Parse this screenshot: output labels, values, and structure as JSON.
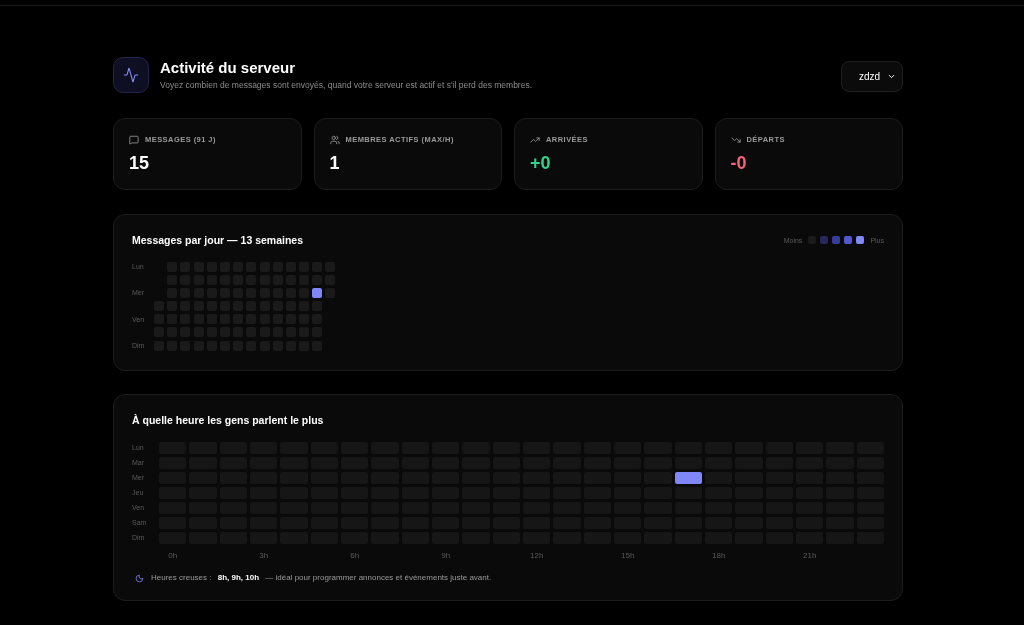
{
  "header": {
    "title": "Activité du serveur",
    "subtitle": "Voyez combien de messages sont envoyés, quand votre serveur est actif et s'il perd des membres."
  },
  "server_select": {
    "value": "zdzd"
  },
  "stats": [
    {
      "kind": "messages",
      "label": "MESSAGES (91 J)",
      "value": "15"
    },
    {
      "kind": "members",
      "label": "MEMBRES ACTIFS (MAX/H)",
      "value": "1"
    },
    {
      "kind": "arrivals",
      "label": "ARRIVÉES",
      "value": "+0"
    },
    {
      "kind": "departures",
      "label": "DÉPARTS",
      "value": "-0"
    }
  ],
  "daily_heatmap": {
    "title": "Messages par jour — 13 semaines",
    "legend": {
      "low": "Moins",
      "high": "Plus",
      "steps": [
        {
          "color": "#1a1a1a"
        },
        {
          "color": "#27285a"
        },
        {
          "color": "#3a3d94"
        },
        {
          "color": "#5459cc"
        },
        {
          "color": "#8087f6"
        }
      ]
    },
    "day_labels": [
      "Lun",
      "Mer",
      "Ven",
      "Dim"
    ],
    "weeks": [
      {
        "days": [
          {
            "color": "#1a1a1a"
          },
          {
            "color": "#1a1a1a"
          },
          {
            "color": "#1a1a1a"
          },
          {
            "color": "#1a1a1a"
          }
        ]
      },
      {
        "days": [
          {
            "color": "#1a1a1a"
          },
          {
            "color": "#1a1a1a"
          },
          {
            "color": "#1a1a1a"
          },
          {
            "color": "#1a1a1a"
          },
          {
            "color": "#1a1a1a"
          },
          {
            "color": "#1a1a1a"
          },
          {
            "color": "#1a1a1a"
          }
        ]
      },
      {
        "days": [
          {
            "color": "#1a1a1a"
          },
          {
            "color": "#1a1a1a"
          },
          {
            "color": "#1a1a1a"
          },
          {
            "color": "#1a1a1a"
          },
          {
            "color": "#1a1a1a"
          },
          {
            "color": "#1a1a1a"
          },
          {
            "color": "#1a1a1a"
          }
        ]
      },
      {
        "days": [
          {
            "color": "#1a1a1a"
          },
          {
            "color": "#1a1a1a"
          },
          {
            "color": "#1a1a1a"
          },
          {
            "color": "#1a1a1a"
          },
          {
            "color": "#1a1a1a"
          },
          {
            "color": "#1a1a1a"
          },
          {
            "color": "#1a1a1a"
          }
        ]
      },
      {
        "days": [
          {
            "color": "#1a1a1a"
          },
          {
            "color": "#1a1a1a"
          },
          {
            "color": "#1a1a1a"
          },
          {
            "color": "#1a1a1a"
          },
          {
            "color": "#1a1a1a"
          },
          {
            "color": "#1a1a1a"
          },
          {
            "color": "#1a1a1a"
          }
        ]
      },
      {
        "days": [
          {
            "color": "#1a1a1a"
          },
          {
            "color": "#1a1a1a"
          },
          {
            "color": "#1a1a1a"
          },
          {
            "color": "#1a1a1a"
          },
          {
            "color": "#1a1a1a"
          },
          {
            "color": "#1a1a1a"
          },
          {
            "color": "#1a1a1a"
          }
        ]
      },
      {
        "days": [
          {
            "color": "#1a1a1a"
          },
          {
            "color": "#1a1a1a"
          },
          {
            "color": "#1a1a1a"
          },
          {
            "color": "#1a1a1a"
          },
          {
            "color": "#1a1a1a"
          },
          {
            "color": "#1a1a1a"
          },
          {
            "color": "#1a1a1a"
          }
        ]
      },
      {
        "days": [
          {
            "color": "#1a1a1a"
          },
          {
            "color": "#1a1a1a"
          },
          {
            "color": "#1a1a1a"
          },
          {
            "color": "#1a1a1a"
          },
          {
            "color": "#1a1a1a"
          },
          {
            "color": "#1a1a1a"
          },
          {
            "color": "#1a1a1a"
          }
        ]
      },
      {
        "days": [
          {
            "color": "#1a1a1a"
          },
          {
            "color": "#1a1a1a"
          },
          {
            "color": "#1a1a1a"
          },
          {
            "color": "#1a1a1a"
          },
          {
            "color": "#1a1a1a"
          },
          {
            "color": "#1a1a1a"
          },
          {
            "color": "#1a1a1a"
          }
        ]
      },
      {
        "days": [
          {
            "color": "#1a1a1a"
          },
          {
            "color": "#1a1a1a"
          },
          {
            "color": "#1a1a1a"
          },
          {
            "color": "#1a1a1a"
          },
          {
            "color": "#1a1a1a"
          },
          {
            "color": "#1a1a1a"
          },
          {
            "color": "#1a1a1a"
          }
        ]
      },
      {
        "days": [
          {
            "color": "#1a1a1a"
          },
          {
            "color": "#1a1a1a"
          },
          {
            "color": "#1a1a1a"
          },
          {
            "color": "#1a1a1a"
          },
          {
            "color": "#1a1a1a"
          },
          {
            "color": "#1a1a1a"
          },
          {
            "color": "#1a1a1a"
          }
        ]
      },
      {
        "days": [
          {
            "color": "#1a1a1a"
          },
          {
            "color": "#1a1a1a"
          },
          {
            "color": "#1a1a1a"
          },
          {
            "color": "#1a1a1a"
          },
          {
            "color": "#1a1a1a"
          },
          {
            "color": "#1a1a1a"
          },
          {
            "color": "#1a1a1a"
          }
        ]
      },
      {
        "days": [
          {
            "color": "#1a1a1a"
          },
          {
            "color": "#1a1a1a"
          },
          {
            "color": "#8087f6"
          },
          {
            "color": "#1a1a1a"
          },
          {
            "color": "#1a1a1a"
          },
          {
            "color": "#1a1a1a"
          },
          {
            "color": "#1a1a1a"
          }
        ]
      },
      {
        "days": [
          {
            "color": "#1a1a1a"
          },
          {
            "color": "#1a1a1a"
          },
          {
            "color": "#1a1a1a"
          }
        ]
      }
    ]
  },
  "hourly_heatmap": {
    "title": "À quelle heure les gens parlent le plus",
    "rows": [
      {
        "label": "Lun",
        "cells": [
          {
            "color": "#161616"
          },
          {
            "color": "#161616"
          },
          {
            "color": "#161616"
          },
          {
            "color": "#161616"
          },
          {
            "color": "#161616"
          },
          {
            "color": "#161616"
          },
          {
            "color": "#161616"
          },
          {
            "color": "#161616"
          },
          {
            "color": "#161616"
          },
          {
            "color": "#161616"
          },
          {
            "color": "#161616"
          },
          {
            "color": "#161616"
          },
          {
            "color": "#161616"
          },
          {
            "color": "#161616"
          },
          {
            "color": "#161616"
          },
          {
            "color": "#161616"
          },
          {
            "color": "#161616"
          },
          {
            "color": "#161616"
          },
          {
            "color": "#161616"
          },
          {
            "color": "#161616"
          },
          {
            "color": "#161616"
          },
          {
            "color": "#161616"
          },
          {
            "color": "#161616"
          },
          {
            "color": "#161616"
          }
        ]
      },
      {
        "label": "Mar",
        "cells": [
          {
            "color": "#161616"
          },
          {
            "color": "#161616"
          },
          {
            "color": "#161616"
          },
          {
            "color": "#161616"
          },
          {
            "color": "#161616"
          },
          {
            "color": "#161616"
          },
          {
            "color": "#161616"
          },
          {
            "color": "#161616"
          },
          {
            "color": "#161616"
          },
          {
            "color": "#161616"
          },
          {
            "color": "#161616"
          },
          {
            "color": "#161616"
          },
          {
            "color": "#161616"
          },
          {
            "color": "#161616"
          },
          {
            "color": "#161616"
          },
          {
            "color": "#161616"
          },
          {
            "color": "#161616"
          },
          {
            "color": "#161616"
          },
          {
            "color": "#161616"
          },
          {
            "color": "#161616"
          },
          {
            "color": "#161616"
          },
          {
            "color": "#161616"
          },
          {
            "color": "#161616"
          },
          {
            "color": "#161616"
          }
        ]
      },
      {
        "label": "Mer",
        "cells": [
          {
            "color": "#161616"
          },
          {
            "color": "#161616"
          },
          {
            "color": "#161616"
          },
          {
            "color": "#161616"
          },
          {
            "color": "#161616"
          },
          {
            "color": "#161616"
          },
          {
            "color": "#161616"
          },
          {
            "color": "#161616"
          },
          {
            "color": "#161616"
          },
          {
            "color": "#161616"
          },
          {
            "color": "#161616"
          },
          {
            "color": "#161616"
          },
          {
            "color": "#161616"
          },
          {
            "color": "#161616"
          },
          {
            "color": "#161616"
          },
          {
            "color": "#161616"
          },
          {
            "color": "#161616"
          },
          {
            "color": "#8087f6"
          },
          {
            "color": "#161616"
          },
          {
            "color": "#161616"
          },
          {
            "color": "#161616"
          },
          {
            "color": "#161616"
          },
          {
            "color": "#161616"
          },
          {
            "color": "#161616"
          }
        ]
      },
      {
        "label": "Jeu",
        "cells": [
          {
            "color": "#161616"
          },
          {
            "color": "#161616"
          },
          {
            "color": "#161616"
          },
          {
            "color": "#161616"
          },
          {
            "color": "#161616"
          },
          {
            "color": "#161616"
          },
          {
            "color": "#161616"
          },
          {
            "color": "#161616"
          },
          {
            "color": "#161616"
          },
          {
            "color": "#161616"
          },
          {
            "color": "#161616"
          },
          {
            "color": "#161616"
          },
          {
            "color": "#161616"
          },
          {
            "color": "#161616"
          },
          {
            "color": "#161616"
          },
          {
            "color": "#161616"
          },
          {
            "color": "#161616"
          },
          {
            "color": "#161616"
          },
          {
            "color": "#161616"
          },
          {
            "color": "#161616"
          },
          {
            "color": "#161616"
          },
          {
            "color": "#161616"
          },
          {
            "color": "#161616"
          },
          {
            "color": "#161616"
          }
        ]
      },
      {
        "label": "Ven",
        "cells": [
          {
            "color": "#161616"
          },
          {
            "color": "#161616"
          },
          {
            "color": "#161616"
          },
          {
            "color": "#161616"
          },
          {
            "color": "#161616"
          },
          {
            "color": "#161616"
          },
          {
            "color": "#161616"
          },
          {
            "color": "#161616"
          },
          {
            "color": "#161616"
          },
          {
            "color": "#161616"
          },
          {
            "color": "#161616"
          },
          {
            "color": "#161616"
          },
          {
            "color": "#161616"
          },
          {
            "color": "#161616"
          },
          {
            "color": "#161616"
          },
          {
            "color": "#161616"
          },
          {
            "color": "#161616"
          },
          {
            "color": "#161616"
          },
          {
            "color": "#161616"
          },
          {
            "color": "#161616"
          },
          {
            "color": "#161616"
          },
          {
            "color": "#161616"
          },
          {
            "color": "#161616"
          },
          {
            "color": "#161616"
          }
        ]
      },
      {
        "label": "Sam",
        "cells": [
          {
            "color": "#161616"
          },
          {
            "color": "#161616"
          },
          {
            "color": "#161616"
          },
          {
            "color": "#161616"
          },
          {
            "color": "#161616"
          },
          {
            "color": "#161616"
          },
          {
            "color": "#161616"
          },
          {
            "color": "#161616"
          },
          {
            "color": "#161616"
          },
          {
            "color": "#161616"
          },
          {
            "color": "#161616"
          },
          {
            "color": "#161616"
          },
          {
            "color": "#161616"
          },
          {
            "color": "#161616"
          },
          {
            "color": "#161616"
          },
          {
            "color": "#161616"
          },
          {
            "color": "#161616"
          },
          {
            "color": "#161616"
          },
          {
            "color": "#161616"
          },
          {
            "color": "#161616"
          },
          {
            "color": "#161616"
          },
          {
            "color": "#161616"
          },
          {
            "color": "#161616"
          },
          {
            "color": "#161616"
          }
        ]
      },
      {
        "label": "Dim",
        "cells": [
          {
            "color": "#161616"
          },
          {
            "color": "#161616"
          },
          {
            "color": "#161616"
          },
          {
            "color": "#161616"
          },
          {
            "color": "#161616"
          },
          {
            "color": "#161616"
          },
          {
            "color": "#161616"
          },
          {
            "color": "#161616"
          },
          {
            "color": "#161616"
          },
          {
            "color": "#161616"
          },
          {
            "color": "#161616"
          },
          {
            "color": "#161616"
          },
          {
            "color": "#161616"
          },
          {
            "color": "#161616"
          },
          {
            "color": "#161616"
          },
          {
            "color": "#161616"
          },
          {
            "color": "#161616"
          },
          {
            "color": "#161616"
          },
          {
            "color": "#161616"
          },
          {
            "color": "#161616"
          },
          {
            "color": "#161616"
          },
          {
            "color": "#161616"
          },
          {
            "color": "#161616"
          },
          {
            "color": "#161616"
          }
        ]
      }
    ],
    "hour_labels": [
      "0h",
      "3h",
      "6h",
      "9h",
      "12h",
      "15h",
      "18h",
      "21h"
    ],
    "note": "Heures creuses : **8h, 9h, 10h** — idéal pour programmer annonces et événements juste avant."
  }
}
